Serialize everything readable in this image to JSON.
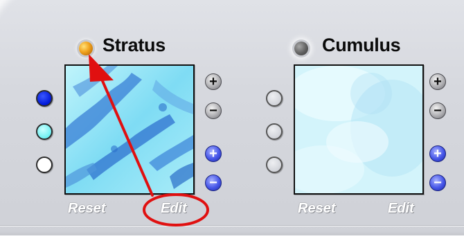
{
  "colors": {
    "accent": "#e01010",
    "led_on": "#f0a21e",
    "led_off": "#555555"
  },
  "stratus": {
    "title": "Stratus",
    "reset_label": "Reset",
    "edit_label": "Edit",
    "add_label": "+",
    "remove_label": "−",
    "add2_label": "+",
    "remove2_label": "−",
    "color_dots": [
      "#0018d8",
      "#6ff0f2",
      "#ffffff"
    ]
  },
  "cumulus": {
    "title": "Cumulus",
    "reset_label": "Reset",
    "edit_label": "Edit",
    "add_label": "+",
    "remove_label": "−",
    "add2_label": "+",
    "remove2_label": "−",
    "color_dots": [
      "empty",
      "empty",
      "empty"
    ]
  }
}
